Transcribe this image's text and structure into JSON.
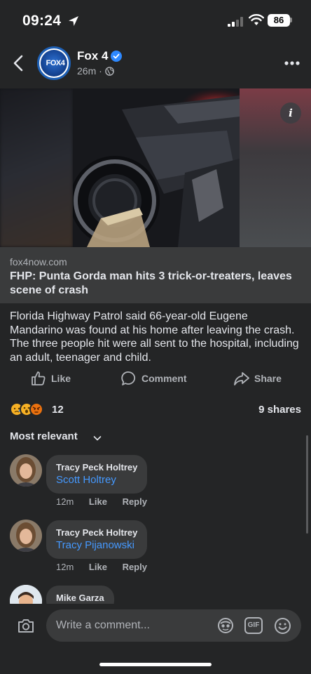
{
  "status_bar": {
    "time": "09:24",
    "battery": "86"
  },
  "header": {
    "page_name": "Fox 4",
    "avatar_text": "FOX4",
    "post_time": "26m ·"
  },
  "link": {
    "domain": "fox4now.com",
    "title": "FHP: Punta Gorda man hits 3 trick-or-treaters, leaves scene of crash"
  },
  "post": {
    "body": "Florida Highway Patrol said 66-year-old Eugene Mandarino was found at his home after leaving the crash. The three people hit were all sent to the hospital, including an adult, teenager and child."
  },
  "actions": {
    "like": "Like",
    "comment": "Comment",
    "share": "Share"
  },
  "engagement": {
    "reaction_count": "12",
    "shares": "9 shares"
  },
  "comments_sort": "Most relevant",
  "comments": [
    {
      "author": "Tracy Peck Holtrey",
      "mention": "Scott Holtrey",
      "time": "12m",
      "like": "Like",
      "reply": "Reply"
    },
    {
      "author": "Tracy Peck Holtrey",
      "mention": "Tracy Pijanowski",
      "time": "12m",
      "like": "Like",
      "reply": "Reply"
    },
    {
      "author": "Mike Garza"
    }
  ],
  "composer": {
    "placeholder": "Write a comment...",
    "gif": "GIF"
  },
  "colors": {
    "background": "#242526",
    "surface": "#3a3b3c",
    "link_blue": "#4599ff",
    "muted": "#b0b3b8",
    "verified": "#2d88ff"
  }
}
